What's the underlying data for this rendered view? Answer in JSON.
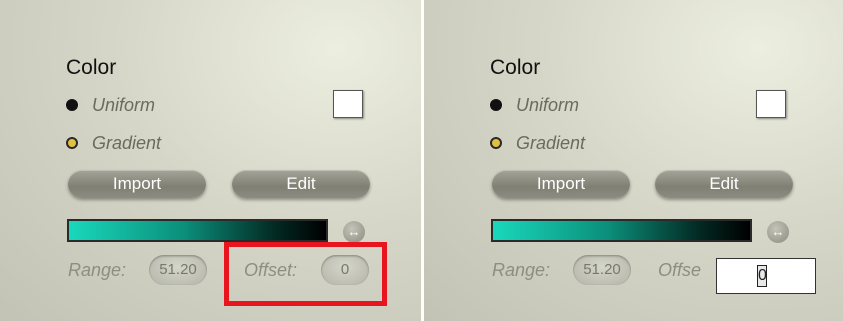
{
  "panels": [
    {
      "title": "Color",
      "options": [
        "Uniform",
        "Gradient"
      ],
      "selected_option": "Gradient",
      "swatch_color": "#ffffff",
      "buttons": {
        "import": "Import",
        "edit": "Edit"
      },
      "gradient": {
        "start": "#19d8bc",
        "end": "#000000"
      },
      "expand_icon": "↔",
      "range": {
        "label": "Range:",
        "value": "51.20"
      },
      "offset": {
        "label": "Offset:",
        "value": "0",
        "highlighted": true,
        "editing": false
      }
    },
    {
      "title": "Color",
      "options": [
        "Uniform",
        "Gradient"
      ],
      "selected_option": "Gradient",
      "swatch_color": "#ffffff",
      "buttons": {
        "import": "Import",
        "edit": "Edit"
      },
      "gradient": {
        "start": "#19d8bc",
        "end": "#000000"
      },
      "expand_icon": "↔",
      "range": {
        "label": "Range:",
        "value": "51.20"
      },
      "offset": {
        "label": "Offse",
        "value": "0",
        "highlighted": false,
        "editing": true
      }
    }
  ],
  "highlight_color": "#e8141e"
}
